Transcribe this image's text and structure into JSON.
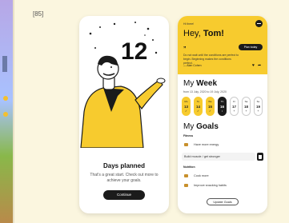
{
  "figure_label": "[85]",
  "colors": {
    "accent": "#f7cb2e",
    "dark": "#1b1b1b",
    "background": "#fbf6df"
  },
  "left_screen": {
    "big_number": "12",
    "title": "Days planned",
    "subtitle": "That's a great start. Check out more to achieve your goals.",
    "cta_label": "Continue"
  },
  "right_screen": {
    "kicker": "Hi there!",
    "greeting_prefix": "Hey, ",
    "greeting_name": "Tom!",
    "plan_button": "Plan today",
    "quote_mark": "”",
    "quote": "Do not wait until the conditions are perfect to begin. Beginning makes the conditions perfect.",
    "author": "— Alan Cohen",
    "week_title_prefix": "My ",
    "week_title_bold": "Week",
    "date_range": "from 13 July, 2020  to 19 July, 2020",
    "days": [
      {
        "dow": "Mo",
        "num": "13",
        "mark": "✓",
        "state": "done"
      },
      {
        "dow": "Tu",
        "num": "14",
        "mark": "✓",
        "state": "done"
      },
      {
        "dow": "We",
        "num": "15",
        "mark": "✓",
        "state": "done"
      },
      {
        "dow": "Th",
        "num": "16",
        "mark": "•",
        "state": "today"
      },
      {
        "dow": "Fr",
        "num": "17",
        "mark": "+",
        "state": "open"
      },
      {
        "dow": "Sa",
        "num": "18",
        "mark": "+",
        "state": "open"
      },
      {
        "dow": "Su",
        "num": "19",
        "mark": "+",
        "state": "open"
      }
    ],
    "goals_title_prefix": "My ",
    "goals_title_bold": "Goals",
    "goal_categories": [
      {
        "name": "Fitness",
        "goals": [
          "Have more energy",
          "Build muscle / get stronger"
        ]
      },
      {
        "name": "Nutrition",
        "goals": [
          "Cook more",
          "Improve snacking habits"
        ]
      }
    ],
    "update_button": "Update Goals"
  }
}
